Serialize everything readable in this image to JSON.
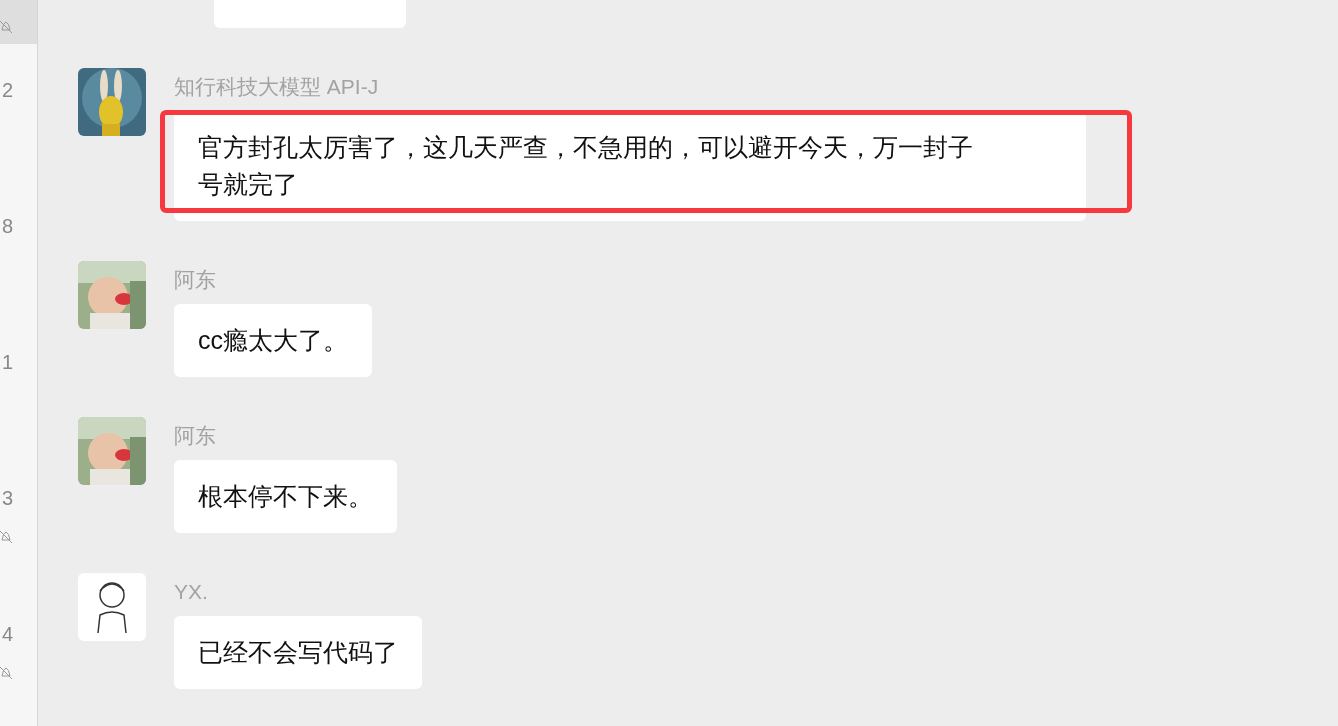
{
  "sidebar": {
    "items": [
      {
        "selected": true,
        "muted": true
      },
      {
        "selected": false,
        "count": "2",
        "muted": false
      },
      {
        "selected": false,
        "count": "8",
        "muted": false
      },
      {
        "selected": false,
        "count": "1",
        "muted": false
      },
      {
        "selected": false,
        "count": "3",
        "muted": true
      },
      {
        "selected": false,
        "count": "4",
        "muted": true
      }
    ]
  },
  "chat": {
    "messages": [
      {
        "kind": "cut"
      },
      {
        "kind": "text",
        "sender": "知行科技大模型 API-J",
        "text": "官方封孔太厉害了，这几天严查，不急用的，可以避开今天，万一封子号就完了",
        "highlighted": true
      },
      {
        "kind": "text",
        "sender": "阿东",
        "text": "cc瘾太大了。",
        "highlighted": false
      },
      {
        "kind": "text",
        "sender": "阿东",
        "text": "根本停不下来。",
        "highlighted": false
      },
      {
        "kind": "text",
        "sender": "YX.",
        "text": "已经不会写代码了",
        "highlighted": false
      }
    ]
  }
}
